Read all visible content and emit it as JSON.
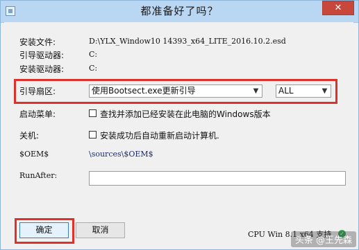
{
  "window": {
    "title": "都准备好了吗？",
    "close_glyph": "✕"
  },
  "rows": {
    "install_file": {
      "label": "安装文件:",
      "value": "D:\\YLX_Window10 14393_x64_LITE_2016.10.2.esd"
    },
    "boot_driver": {
      "label": "引导驱动器:",
      "value": "C:"
    },
    "install_driver": {
      "label": "安装驱动器:",
      "value": "C:"
    },
    "boot_sector": {
      "label": "引导扇区:",
      "method_selected": "使用Bootsect.exe更新引导",
      "target_selected": "ALL"
    },
    "boot_menu": {
      "label": "启动菜单:",
      "checkbox_text": "查找并添加已经安装在此电脑的Windows版本",
      "checked": false
    },
    "shutdown": {
      "label": "关机:",
      "checkbox_text": "安装成功后自动重新启动计算机.",
      "checked": false
    },
    "oem": {
      "label": "$OEM$",
      "value": "\\sources\\$OEM$"
    },
    "run_after": {
      "label": "RunAfter:",
      "value": ""
    }
  },
  "buttons": {
    "ok": "确定",
    "cancel": "取消"
  },
  "status": {
    "text": "CPU Win 8.1 x64 支持"
  },
  "watermark": "头条 @王先森",
  "colors": {
    "highlight": "#e0302a",
    "title_bar": "#b9d6f2",
    "close": "#c7473d"
  }
}
